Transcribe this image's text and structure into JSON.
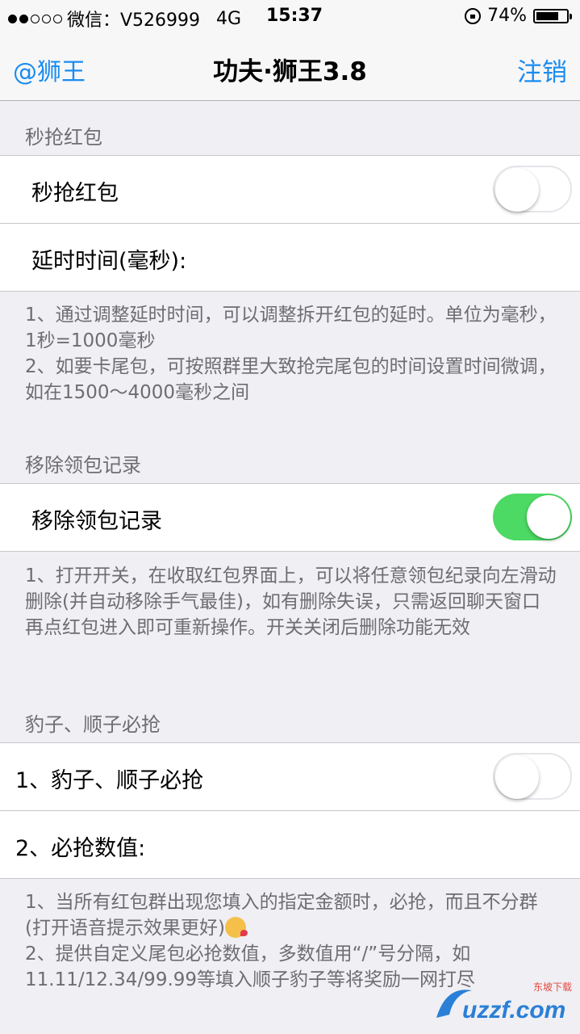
{
  "status_bar": {
    "carrier": "微信：V526999",
    "network": "4G",
    "time": "15:37",
    "battery": "74%",
    "battery_level": 0.74
  },
  "nav": {
    "left": "@狮王",
    "title": "功夫·狮王3.8",
    "right": "注销"
  },
  "sections": [
    {
      "header": "秒抢红包",
      "rows": [
        {
          "label": "秒抢红包",
          "toggle": false
        },
        {
          "label": "延时时间(毫秒):"
        }
      ],
      "footer": [
        "1、通过调整延时时间，可以调整拆开红包的延时。单位为毫秒，1秒=1000毫秒",
        "2、如要卡尾包，可按照群里大致抢完尾包的时间设置时间微调，如在1500～4000毫秒之间"
      ]
    },
    {
      "header": "移除领包记录",
      "rows": [
        {
          "label": "移除领包记录",
          "toggle": true
        }
      ],
      "footer": [
        "1、打开开关，在收取红包界面上，可以将任意领包纪录向左滑动删除(并自动移除手气最佳)，如有删除失误，只需返回聊天窗口再点红包进入即可重新操作。开关关闭后删除功能无效"
      ]
    },
    {
      "header": "豹子、顺子必抢",
      "rows": [
        {
          "label": "1、豹子、顺子必抢",
          "toggle": false
        },
        {
          "label": "2、必抢数值:"
        }
      ],
      "footer": [
        "1、当所有红包群出现您填入的指定金额时，必抢，而且不分群(打开语音提示效果更好)",
        "2、提供自定义尾包必抢数值，多数值用“/”号分隔，如11.11/12.34/99.99等填入顺子豹子等将奖励一网打尽"
      ]
    }
  ],
  "watermark": {
    "text": "uzzf.com",
    "sub": "东坡下载"
  }
}
